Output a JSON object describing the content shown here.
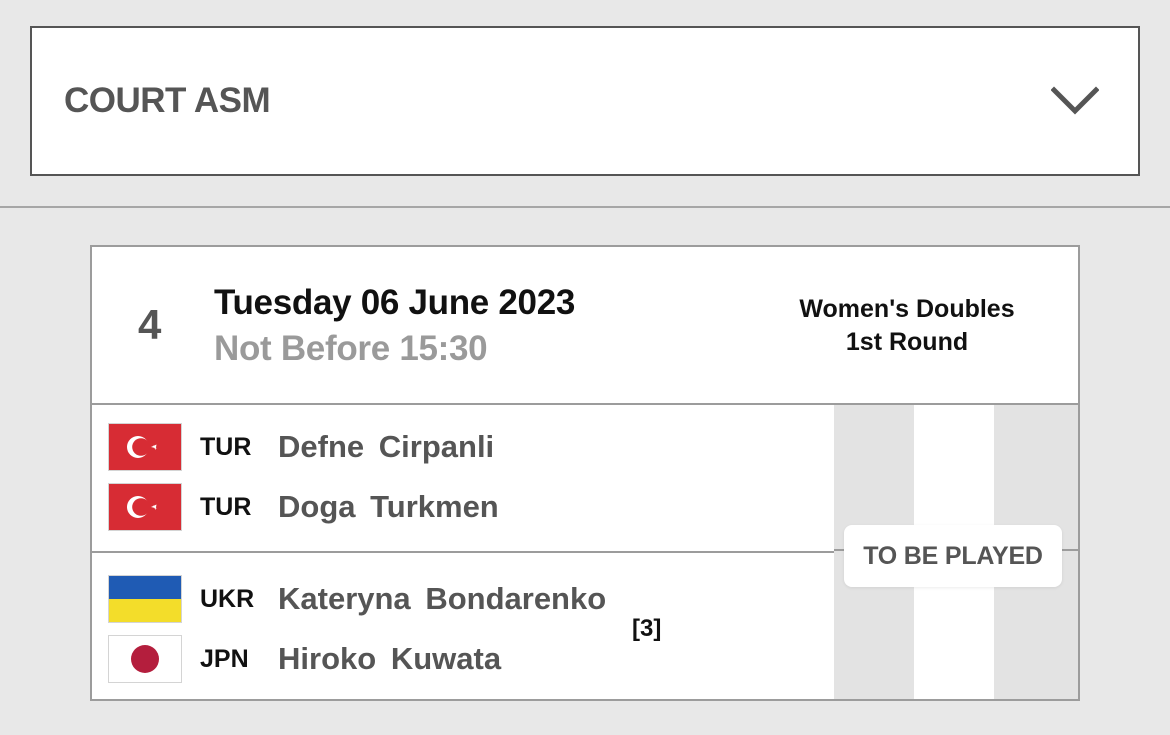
{
  "court_selector": {
    "label": "COURT ASM",
    "icon": "chevron-down-icon"
  },
  "match": {
    "number": "4",
    "date": "Tuesday 06 June 2023",
    "time": "Not Before 15:30",
    "event": "Women's Doubles",
    "round": "1st Round",
    "status": "TO BE PLAYED",
    "teams": [
      {
        "seed": "",
        "players": [
          {
            "country": "TUR",
            "flag": "turkey-flag",
            "first": "Defne",
            "last": "Cirpanli"
          },
          {
            "country": "TUR",
            "flag": "turkey-flag",
            "first": "Doga",
            "last": "Turkmen"
          }
        ]
      },
      {
        "seed": "[3]",
        "players": [
          {
            "country": "UKR",
            "flag": "ukraine-flag",
            "first": "Kateryna",
            "last": "Bondarenko"
          },
          {
            "country": "JPN",
            "flag": "japan-flag",
            "first": "Hiroko",
            "last": "Kuwata"
          }
        ]
      }
    ]
  },
  "colors": {
    "turkey_red": "#d72c34",
    "ukraine_blue": "#1f5bb4",
    "ukraine_yellow": "#f3dd2a",
    "japan_red": "#b41e3d"
  }
}
